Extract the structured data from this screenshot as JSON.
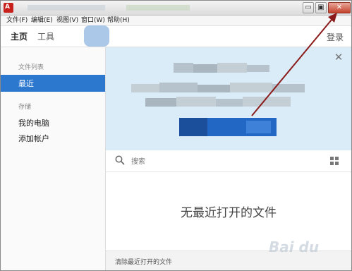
{
  "menu": {
    "items": [
      "文件(F)",
      "编辑(E)",
      "视图(V)",
      "窗口(W)",
      "帮助(H)"
    ]
  },
  "window_buttons": {
    "minimize": "▭",
    "restore": "▣",
    "close": "✕"
  },
  "tabs": {
    "home": "主页",
    "tools": "工具",
    "login": "登录"
  },
  "sidebar": {
    "file_list_heading": "文件列表",
    "recent": "最近",
    "storage_heading": "存储",
    "my_computer": "我的电脑",
    "add_account": "添加帐户"
  },
  "banner": {
    "close": "✕"
  },
  "search": {
    "placeholder": "搜索"
  },
  "main": {
    "empty_message": "无最近打开的文件"
  },
  "footer": {
    "clear_recent": "清除最近打开的文件"
  },
  "colors": {
    "accent": "#2d78cf",
    "banner_bg": "#d9ecf8",
    "annotation_arrow": "#8b1a1a"
  },
  "icons": [
    "app-logo-icon",
    "search-icon",
    "grid-view-icon",
    "close-icon",
    "annotation-arrow"
  ]
}
